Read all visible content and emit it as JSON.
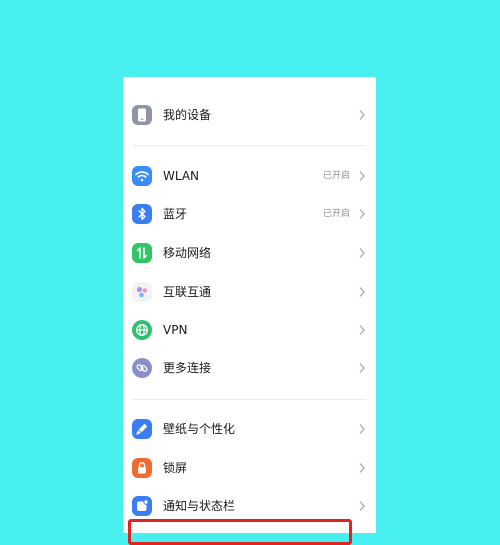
{
  "colors": {
    "background": "#47F0EE",
    "highlight_border": "#E02424",
    "device_icon": "#8F94A8",
    "wlan_icon": "#3A8DF5",
    "bluetooth_icon": "#3A7DF5",
    "mobile_icon": "#33C46A",
    "vpn_icon": "#2FC26E",
    "more_icon": "#8A8FC9",
    "wallpaper_icon": "#3A7DF5",
    "lock_icon": "#F26A2E",
    "notification_icon": "#3A7DF5"
  },
  "settings": {
    "my_device": {
      "label": "我的设备",
      "icon": "phone-icon"
    },
    "wlan": {
      "label": "WLAN",
      "status": "已开启",
      "icon": "wifi-icon"
    },
    "bluetooth": {
      "label": "蓝牙",
      "status": "已开启",
      "icon": "bluetooth-icon"
    },
    "mobile_network": {
      "label": "移动网络",
      "icon": "mobile-data-icon"
    },
    "interconnect": {
      "label": "互联互通",
      "icon": "interconnect-icon"
    },
    "vpn": {
      "label": "VPN",
      "icon": "globe-icon"
    },
    "more_connections": {
      "label": "更多连接",
      "icon": "link-icon"
    },
    "wallpaper": {
      "label": "壁纸与个性化",
      "icon": "brush-icon"
    },
    "lock_screen": {
      "label": "锁屏",
      "icon": "lock-icon"
    },
    "notifications": {
      "label": "通知与状态栏",
      "icon": "notification-icon"
    }
  }
}
